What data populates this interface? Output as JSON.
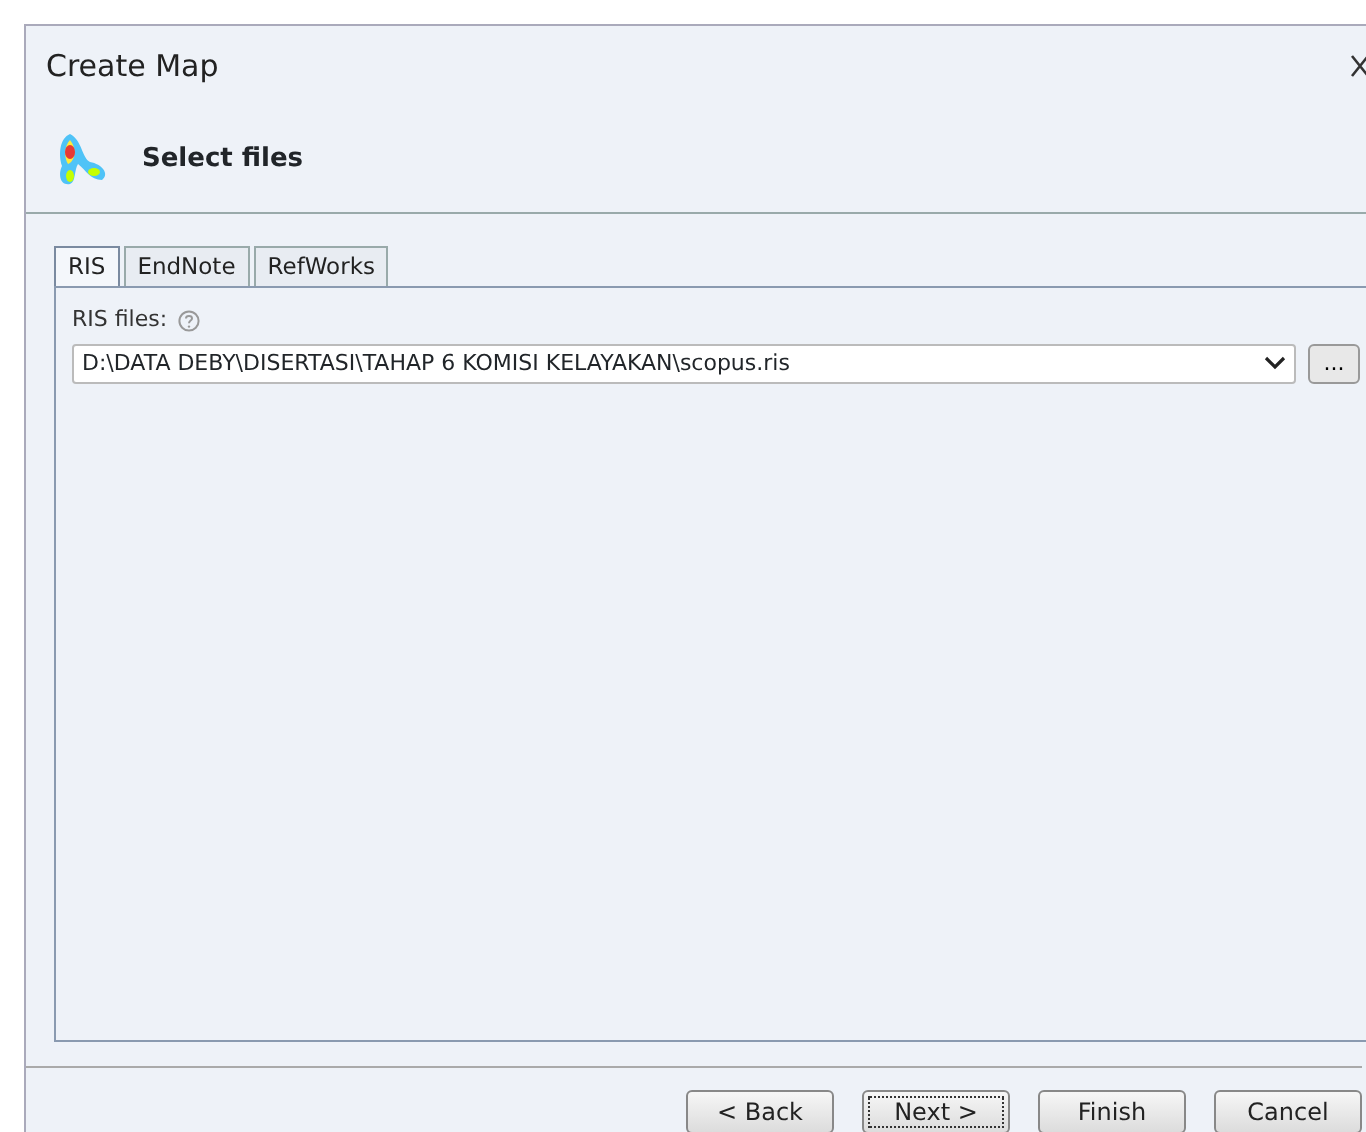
{
  "window": {
    "title": "Create Map"
  },
  "header": {
    "title": "Select files"
  },
  "tabs": [
    {
      "label": "RIS",
      "selected": true
    },
    {
      "label": "EndNote",
      "selected": false
    },
    {
      "label": "RefWorks",
      "selected": false
    }
  ],
  "file_field": {
    "label": "RIS files:",
    "value": "D:\\DATA DEBY\\DISERTASI\\TAHAP 6 KOMISI KELAYAKAN\\scopus.ris",
    "browse_label": "..."
  },
  "buttons": [
    {
      "label": "< Back",
      "focused": false
    },
    {
      "label": "Next >",
      "focused": true
    },
    {
      "label": "Finish",
      "focused": false
    },
    {
      "label": "Cancel",
      "focused": false
    }
  ]
}
